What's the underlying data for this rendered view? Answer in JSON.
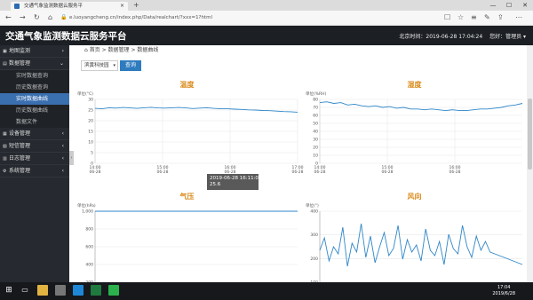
{
  "browser": {
    "tab_title": "交通气象监测数据云服务平",
    "tab_close": "×",
    "new_tab": "+",
    "url": "e.luoyangcheng.cn/index.php/Data/realchart/?xxx=1?html",
    "win_min": "—",
    "win_max": "☐",
    "win_close": "✕"
  },
  "header": {
    "title": "交通气象监测数据云服务平台",
    "time_label": "北京时间：2019-06-28 17:04:24",
    "user_label": "您好：管理员 ▾"
  },
  "sidebar": {
    "items": [
      {
        "label": "地图监测",
        "chev": "›"
      },
      {
        "label": "数据管理",
        "chev": "⌄"
      }
    ],
    "sub_items": [
      "实时数据查询",
      "历史数据查询",
      "实时数据曲线",
      "历史数据曲线",
      "数据文件"
    ],
    "items2": [
      {
        "label": "设备管理",
        "chev": "‹"
      },
      {
        "label": "短信管理",
        "chev": "‹"
      },
      {
        "label": "日志管理",
        "chev": "‹"
      },
      {
        "label": "系统管理",
        "chev": "‹"
      }
    ]
  },
  "main": {
    "breadcrumb": "⌂ 首页  >  数据管理  >  数据曲线",
    "station_select": "滨黄科技园",
    "query_button": "查询"
  },
  "tooltip": {
    "time": "2019-06-28 16:11:00",
    "value": "25.6"
  },
  "taskbar": {
    "time": "17:04",
    "date": "2019/6/28"
  },
  "colors": {
    "line": "#2e86c8",
    "title": "#d98a1a",
    "header": "#1c1f24",
    "sidebar": "#262a30",
    "active": "#3a6fb0"
  },
  "chart_data": [
    {
      "type": "line",
      "title": "温度",
      "ylabel": "单位(°C)",
      "ylim": [
        0,
        30
      ],
      "yticks": [
        "30",
        "25",
        "20",
        "15",
        "10",
        "5",
        "0"
      ],
      "xticks": [
        "14:00\n06-28",
        "15:00\n06-28",
        "16:00\n06-28",
        "17:00\n06-28"
      ],
      "series": [
        {
          "values": [
            25.8,
            25.6,
            26.1,
            25.9,
            26.2,
            26.0,
            25.8,
            26.1,
            26.3,
            26.0,
            25.9,
            26.1,
            26.2,
            26.0,
            25.7,
            25.9,
            26.1,
            25.8,
            25.6,
            25.6,
            25.4,
            25.3,
            25.1,
            25.0,
            24.8,
            24.7,
            24.5,
            24.3,
            24.2,
            24.0
          ]
        }
      ]
    },
    {
      "type": "line",
      "title": "湿度",
      "ylabel": "单位(%RH)",
      "ylim": [
        0,
        80
      ],
      "yticks": [
        "80",
        "70",
        "60",
        "50",
        "40",
        "30",
        "20",
        "10",
        "0"
      ],
      "xticks": [
        "14:00\n06-28",
        "15:00\n06-28",
        "16:00\n06-28"
      ],
      "series": [
        {
          "values": [
            76,
            77,
            75,
            76,
            73,
            74,
            72,
            71,
            72,
            70,
            71,
            69,
            70,
            68,
            68,
            67,
            68,
            67,
            66,
            67,
            66,
            66,
            67,
            68,
            68,
            69,
            70,
            72,
            73,
            75
          ]
        }
      ]
    },
    {
      "type": "line",
      "title": "气压",
      "ylabel": "单位(hPa)",
      "ylim": [
        0,
        1000
      ],
      "yticks": [
        "1,000",
        "800",
        "600",
        "400",
        "200"
      ],
      "series": [
        {
          "values": [
            1000,
            1000,
            1000,
            1000,
            1000,
            1000,
            1000,
            1000,
            1000,
            1000,
            1000,
            1000,
            1000,
            1000,
            1000,
            1000,
            1000,
            1000,
            1000,
            1000,
            1000,
            1000,
            1000,
            1000,
            1000,
            1000,
            1000,
            1000,
            1000,
            1000
          ]
        }
      ]
    },
    {
      "type": "line",
      "title": "风向",
      "ylabel": "单位(°)",
      "ylim": [
        0,
        400
      ],
      "yticks": [
        "400",
        "300",
        "200",
        "100"
      ],
      "series": [
        {
          "values": [
            180,
            250,
            120,
            200,
            160,
            310,
            90,
            220,
            170,
            330,
            140,
            260,
            110,
            200,
            280,
            150,
            190,
            320,
            130,
            240,
            170,
            210,
            120,
            300,
            180,
            150,
            230,
            100,
            270,
            190,
            160,
            320,
            200,
            140,
            260,
            180,
            230,
            170,
            160,
            150,
            140,
            130,
            120,
            110,
            100
          ]
        }
      ]
    }
  ]
}
